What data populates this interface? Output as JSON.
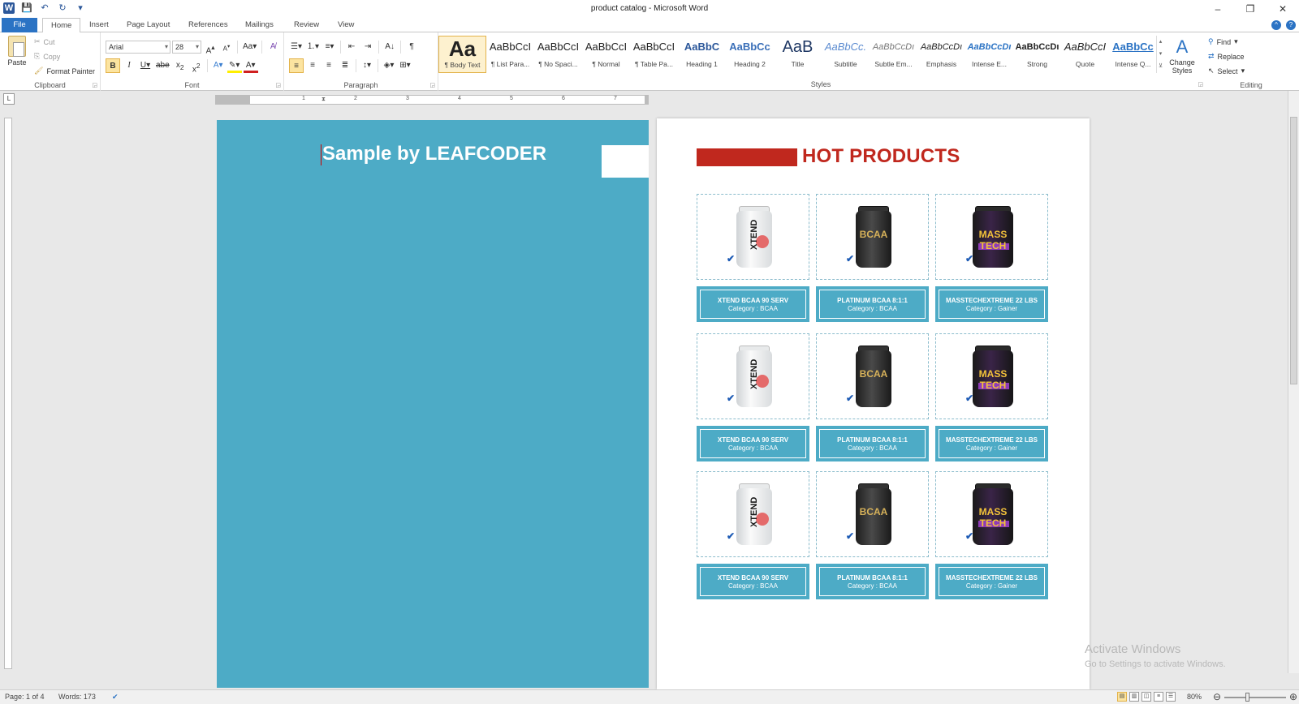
{
  "window": {
    "title": "product catalog  -  Microsoft Word",
    "minimize": "–",
    "restore": "❐",
    "close": "✕"
  },
  "tabs": [
    "File",
    "Home",
    "Insert",
    "Page Layout",
    "References",
    "Mailings",
    "Review",
    "View"
  ],
  "clipboard": {
    "paste": "Paste",
    "cut": "Cut",
    "copy": "Copy",
    "format_painter": "Format Painter",
    "label": "Clipboard"
  },
  "font": {
    "name": "Arial",
    "size": "28",
    "label": "Font"
  },
  "paragraph": {
    "label": "Paragraph"
  },
  "styles": {
    "label": "Styles",
    "items": [
      {
        "sample": "Aa",
        "name": "¶ Body Text"
      },
      {
        "sample": "AaBbCcI",
        "name": "¶ List Para..."
      },
      {
        "sample": "AaBbCcI",
        "name": "¶ No Spaci..."
      },
      {
        "sample": "AaBbCcI",
        "name": "¶ Normal"
      },
      {
        "sample": "AaBbCcI",
        "name": "¶ Table Pa..."
      },
      {
        "sample": "AaBbC",
        "name": "Heading 1"
      },
      {
        "sample": "AaBbCc",
        "name": "Heading 2"
      },
      {
        "sample": "AaB",
        "name": "Title"
      },
      {
        "sample": "AaBbCc.",
        "name": "Subtitle"
      },
      {
        "sample": "AaBbCcDı",
        "name": "Subtle Em..."
      },
      {
        "sample": "AaBbCcDı",
        "name": "Emphasis"
      },
      {
        "sample": "AaBbCcDı",
        "name": "Intense E..."
      },
      {
        "sample": "AaBbCcDı",
        "name": "Strong"
      },
      {
        "sample": "AaBbCcI",
        "name": "Quote"
      },
      {
        "sample": "AaBbCc",
        "name": "Intense Q..."
      }
    ],
    "change_styles": "Change Styles"
  },
  "editing": {
    "find": "Find",
    "replace": "Replace",
    "select": "Select",
    "label": "Editing"
  },
  "ruler": [
    "1",
    "2",
    "3",
    "4",
    "5",
    "6",
    "7"
  ],
  "document": {
    "left_title": "Sample by LEAFCODER",
    "right_title": "HOT PRODUCTS",
    "rows": [
      [
        {
          "kind": "xtend",
          "brand": "XTEND",
          "name": "XTEND BCAA 90 SERV",
          "category": "Category : BCAA"
        },
        {
          "kind": "bcaa",
          "brand": "BCAA",
          "name": "PLATINUM BCAA 8:1:1",
          "category": "Category : BCAA"
        },
        {
          "kind": "mass",
          "brand": "MASS TECH",
          "name": "MASSTECHEXTREME 22 LBS",
          "category": "Category : Gainer"
        }
      ],
      [
        {
          "kind": "xtend",
          "brand": "XTEND",
          "name": "XTEND BCAA 90 SERV",
          "category": "Category : BCAA"
        },
        {
          "kind": "bcaa",
          "brand": "BCAA",
          "name": "PLATINUM BCAA 8:1:1",
          "category": "Category : BCAA"
        },
        {
          "kind": "mass",
          "brand": "MASS TECH",
          "name": "MASSTECHEXTREME 22 LBS",
          "category": "Category : Gainer"
        }
      ],
      [
        {
          "kind": "xtend",
          "brand": "XTEND",
          "name": "XTEND BCAA 90 SERV",
          "category": "Category : BCAA"
        },
        {
          "kind": "bcaa",
          "brand": "BCAA",
          "name": "PLATINUM BCAA 8:1:1",
          "category": "Category : BCAA"
        },
        {
          "kind": "mass",
          "brand": "MASS TECH",
          "name": "MASSTECHEXTREME 22 LBS",
          "category": "Category : Gainer"
        }
      ]
    ]
  },
  "watermark": {
    "line1": "Activate Windows",
    "line2": "Go to Settings to activate Windows."
  },
  "status": {
    "page": "Page: 1 of 4",
    "words": "Words: 173",
    "zoom": "80%"
  },
  "colors": {
    "accent": "#2b73c4",
    "page_left_bg": "#4dabc6",
    "hot_red": "#c0281e"
  }
}
